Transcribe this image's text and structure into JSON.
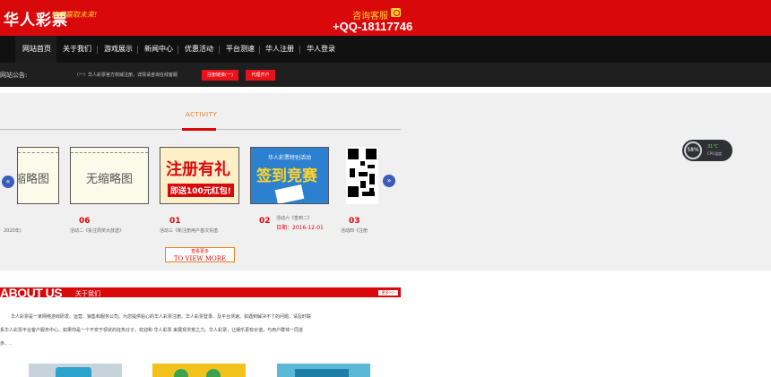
{
  "header": {
    "logo": "华人彩票",
    "slogan": "快乐赢取未来!",
    "contact_label": "咨询客服",
    "contact_phone": "+QQ-18117746"
  },
  "nav": {
    "items": [
      "网站首页",
      "关于我们",
      "游戏展示",
      "新闻中心",
      "优惠活动",
      "平台测速",
      "华人注册",
      "华人登录"
    ]
  },
  "notice": {
    "label": "网站公告:",
    "text": "（一）华人彩票官方权威注册，详情请咨询在线客服",
    "btn_register": "注册链接(一)",
    "btn_agent": "代理开户"
  },
  "activity": {
    "title": "ACTIVITY",
    "placeholder_1": "缩略图",
    "placeholder_2": "无缩略图",
    "reg_big": "注册有礼",
    "reg_small": "即送100元红包!",
    "sign_top": "华人彩票特别活动",
    "sign_big": "签到竞赛",
    "prev_icon": "«",
    "next_icon": "»",
    "items": [
      {
        "num": "",
        "caption": "活动",
        "suffix": "2020年)"
      },
      {
        "num": "06",
        "caption": "活动二《投注周奖大放送》"
      },
      {
        "num": "01",
        "caption": "活动三《新注册用户首次充值"
      },
      {
        "num": "02",
        "caption": "活动六《签到二》",
        "date": "日期：2016-12-01"
      },
      {
        "num": "03",
        "caption": "活动四《注册"
      }
    ],
    "view_more_cn": "查看更多",
    "view_more_en": "TO VIEW MORE"
  },
  "cpu": {
    "percent": "58%",
    "temp": "31℃",
    "label": "CPU温度"
  },
  "about": {
    "title_en": "ABOUT US",
    "title_cn": "关于我们",
    "more": "更多>>",
    "line1": "华人彩票是一家网络游戏研发、运营、销售和服务公司。为您提供贴心的华人彩票注册、华人彩票登录、及平台测速。如遇到解决不了的问题，请及时联",
    "line2": "系华人彩票平台客户服务中心。如果你是一个不安于现状的狂热分子，欢迎和 华人彩票 来展现洪荒之力。华人彩票，让娱乐更有价值，与用户群体一同进",
    "line3": "步。.."
  },
  "colors": {
    "brand_red": "#d9080b",
    "accent_gold": "#ffd42a",
    "accent_orange": "#e7811c",
    "nav_bg": "#111111"
  }
}
